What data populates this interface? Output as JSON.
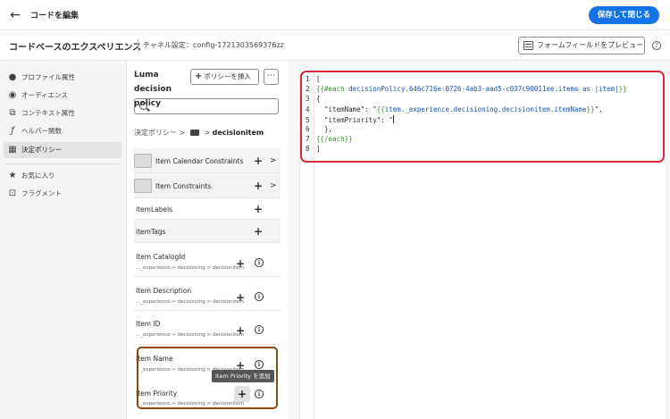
{
  "topbar": {
    "title": "コードを編集",
    "save_label": "保存して閉じる"
  },
  "header": {
    "title": "コードベースのエクスペリエンス",
    "channel": "チャネル設定：config-1721303569376zz",
    "preview_label": "フォームフィールドをプレビュー",
    "help_glyph": "?"
  },
  "sidebar": {
    "items": [
      {
        "label": "プロファイル属性",
        "icon": "person-icon",
        "glyph": "👤"
      },
      {
        "label": "オーディエンス",
        "icon": "audience-icon",
        "glyph": "◉"
      },
      {
        "label": "コンテキスト属性",
        "icon": "context-icon",
        "glyph": "⧉"
      },
      {
        "label": "ヘルパー関数",
        "icon": "function-icon",
        "glyph": "ƒ"
      },
      {
        "label": "決定ポリシー",
        "icon": "decision-icon",
        "glyph": "▦"
      },
      {
        "label": "お気に入り",
        "icon": "star-icon",
        "glyph": "★"
      },
      {
        "label": "フラグメント",
        "icon": "fragment-icon",
        "glyph": "⊡"
      }
    ]
  },
  "panel": {
    "title": "Luma decision policy",
    "insert_label": "ポリシーを挿入",
    "insert_glyph": "+",
    "more_glyph": "···",
    "search_placeholder": "",
    "breadcrumb_root": "決定ポリシー",
    "breadcrumb_sep1": ">",
    "breadcrumb_sep2": ">",
    "breadcrumb_current": "decisionitem",
    "plus_glyph": "+",
    "chevron_glyph": ">",
    "info_glyph": "i",
    "rows": [
      {
        "label": "Item Calendar Constraints",
        "kind": "folder"
      },
      {
        "label": "Item Constraints",
        "kind": "folder"
      },
      {
        "label": "itemLabels",
        "kind": "simple"
      },
      {
        "label": "itemTags",
        "kind": "simple"
      },
      {
        "label": "Item CatalogId",
        "path": "..._experience > decisioning > decisionitem",
        "kind": "attr"
      },
      {
        "label": "Item Description",
        "path": "..._experience > decisioning > decisionitem",
        "kind": "attr"
      },
      {
        "label": "Item ID",
        "path": "..._experience > decisioning > decisionitem",
        "kind": "attr"
      },
      {
        "label": "Item Name",
        "path": "..._experience > decisioning > decisionitem",
        "kind": "attr"
      },
      {
        "label": "Item Priority",
        "path": "..._experience > decisioning > decisionitem",
        "kind": "attr"
      }
    ],
    "tooltip": "Item Priority を追加"
  },
  "editor": {
    "lines": [
      {
        "n": "1",
        "parts": [
          {
            "t": "[",
            "c": ""
          }
        ]
      },
      {
        "n": "2",
        "parts": [
          {
            "t": "{{#each ",
            "c": "hbs"
          },
          {
            "t": "decisionPolicy.646c716e-0726-4ab3-aad5-c037c90011ee.items as |item|",
            "c": "kw"
          },
          {
            "t": "}}",
            "c": "hbs"
          }
        ]
      },
      {
        "n": "3",
        "parts": [
          {
            "t": "{",
            "c": ""
          }
        ]
      },
      {
        "n": "4",
        "parts": [
          {
            "t": "  \"itemName\": \"",
            "c": ""
          },
          {
            "t": "{{",
            "c": "hbs"
          },
          {
            "t": "item._experience.decisioning.decisionitem.itemName",
            "c": "kw"
          },
          {
            "t": "}}",
            "c": "hbs"
          },
          {
            "t": "\",",
            "c": ""
          }
        ]
      },
      {
        "n": "5",
        "parts": [
          {
            "t": "  \"itemPriority\": \"",
            "c": ""
          }
        ]
      },
      {
        "n": "6",
        "parts": [
          {
            "t": "  },",
            "c": ""
          }
        ]
      },
      {
        "n": "7",
        "parts": [
          {
            "t": "{{/each}}",
            "c": "hbs"
          }
        ]
      },
      {
        "n": "8",
        "parts": [
          {
            "t": "]",
            "c": ""
          }
        ]
      }
    ]
  },
  "colors": {
    "accent": "#1473e6",
    "code_highlight_border": "#d9283a",
    "item_highlight_border": "#8a4a16",
    "handlebars": "#3a8a30",
    "expression": "#1a55b0"
  }
}
